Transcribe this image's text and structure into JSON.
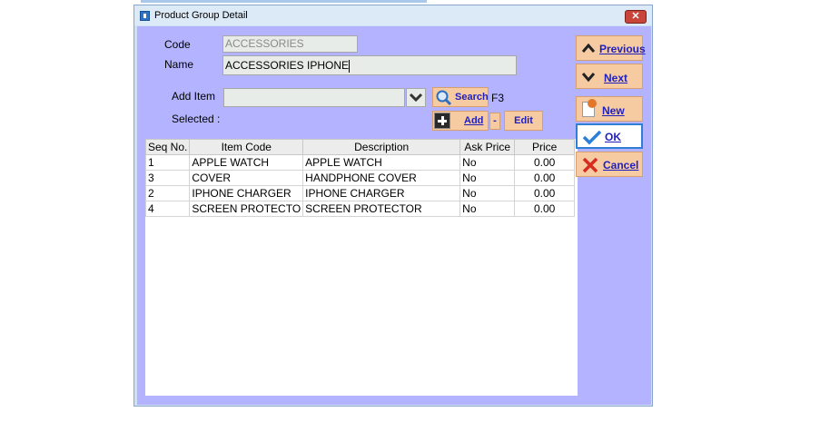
{
  "window": {
    "title": "Product Group Detail",
    "close_label": "✕"
  },
  "form": {
    "code_label": "Code",
    "code_value": "ACCESSORIES",
    "name_label": "Name",
    "name_value": "ACCESSORIES IPHONE",
    "add_item_label": "Add Item",
    "selected_label": "Selected :",
    "search_label": "Search",
    "search_shortcut": "F3",
    "add_label": "Add",
    "minus_label": "-",
    "edit_label": "Edit"
  },
  "table": {
    "columns": [
      "Seq No.",
      "Item Code",
      "Description",
      "Ask Price",
      "Price"
    ],
    "rows": [
      {
        "seq": "1",
        "code": "APPLE WATCH",
        "desc": "APPLE WATCH",
        "ask": "No",
        "price": "0.00"
      },
      {
        "seq": "3",
        "code": "COVER",
        "desc": "HANDPHONE COVER",
        "ask": "No",
        "price": "0.00"
      },
      {
        "seq": "2",
        "code": "IPHONE CHARGER",
        "desc": "IPHONE CHARGER",
        "ask": "No",
        "price": "0.00"
      },
      {
        "seq": "4",
        "code": "SCREEN PROTECTO",
        "desc": "SCREEN PROTECTOR",
        "ask": "No",
        "price": "0.00"
      }
    ]
  },
  "side": {
    "previous_label": "Previous",
    "next_label": "Next",
    "new_label": "New",
    "ok_label": "OK",
    "cancel_label": "Cancel"
  },
  "colors": {
    "client_bg": "#b3b3ff",
    "button_bg": "#f6cba2",
    "button_text": "#1f1fbf"
  }
}
